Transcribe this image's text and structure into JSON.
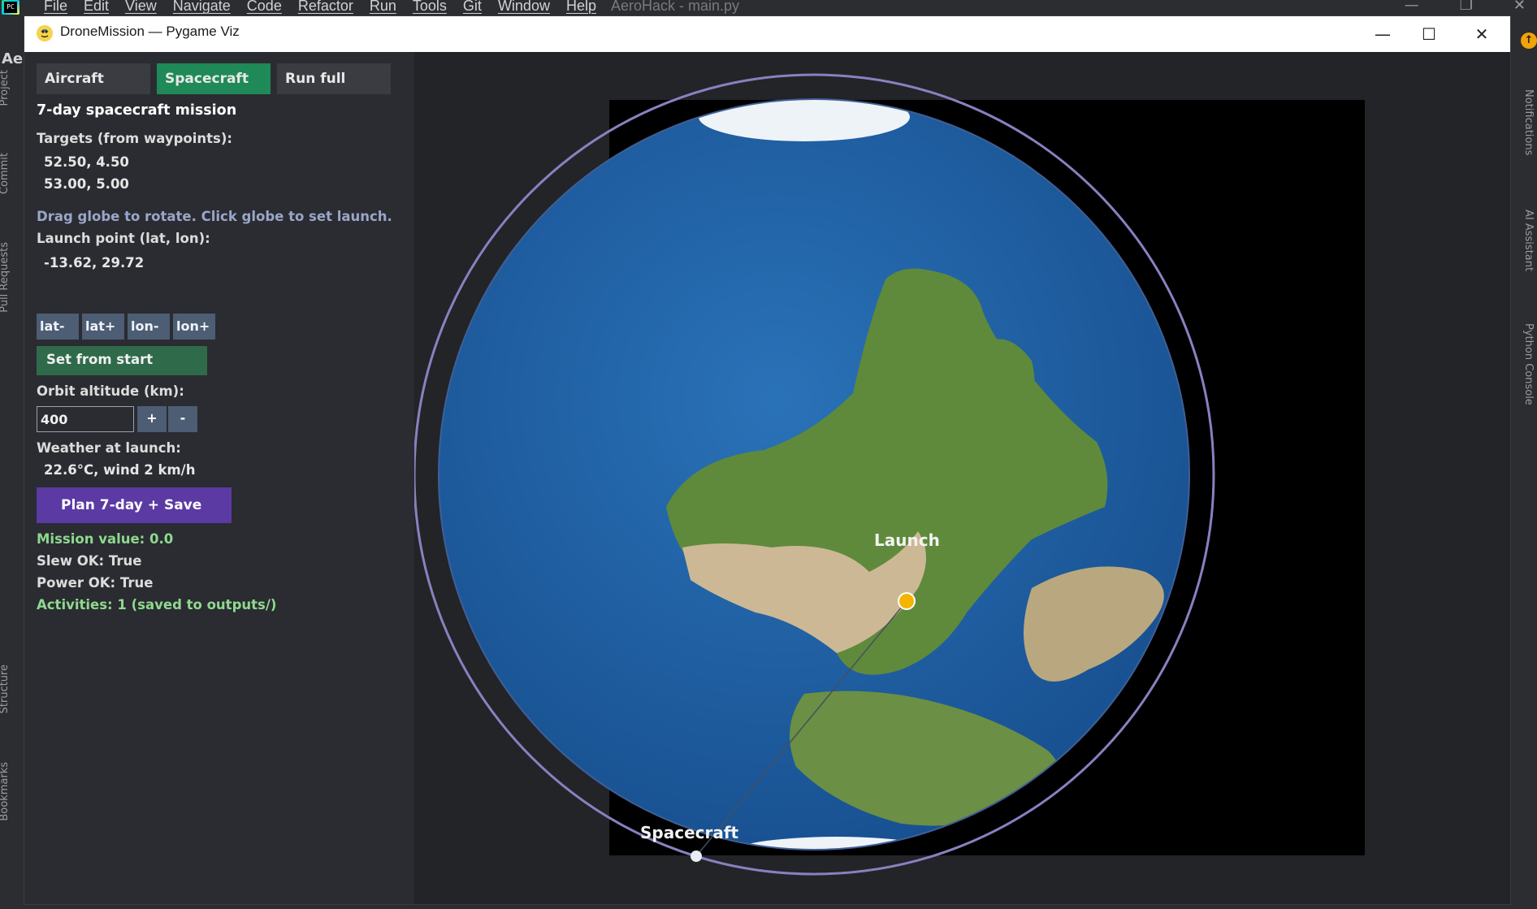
{
  "ide": {
    "logo": "PC",
    "menu": [
      "File",
      "Edit",
      "View",
      "Navigate",
      "Code",
      "Refactor",
      "Run",
      "Tools",
      "Git",
      "Window",
      "Help"
    ],
    "project_title": "AeroHack - main.py",
    "project_abbr": "Ae",
    "left_tabs": [
      "Project",
      "Commit",
      "Pull Requests",
      "Structure",
      "Bookmarks"
    ],
    "right_tabs": [
      "Notifications",
      "AI Assistant",
      "Python Console"
    ]
  },
  "window": {
    "title": "DroneMission — Pygame Viz",
    "controls": {
      "minimize": "—",
      "maximize": "☐",
      "close": "✕"
    }
  },
  "sidebar": {
    "tabs": [
      {
        "label": "Aircraft",
        "active": false
      },
      {
        "label": "Spacecraft",
        "active": true
      },
      {
        "label": "Run full",
        "active": false
      }
    ],
    "mission_title": "7-day spacecraft mission",
    "targets_header": "Targets (from waypoints):",
    "targets": [
      "52.50, 4.50",
      "53.00, 5.00"
    ],
    "drag_hint": "Drag globe to rotate. Click globe to set launch.",
    "launch_header": "Launch point (lat, lon):",
    "launch_value": "-13.62, 29.72",
    "adjust_buttons": [
      "lat-",
      "lat+",
      "lon-",
      "lon+"
    ],
    "set_from_start": "Set from start",
    "altitude_header": "Orbit altitude (km):",
    "altitude_value": "400",
    "altitude_plus": "+",
    "altitude_minus": "-",
    "weather_header": "Weather at launch:",
    "weather_value": "22.6°C, wind 2 km/h",
    "plan_button": "Plan 7-day + Save",
    "mission_value": "Mission value: 0.0",
    "slew_ok": "Slew OK: True",
    "power_ok": "Power OK: True",
    "activities": "Activities: 1 (saved to outputs/)"
  },
  "globe": {
    "launch_label": "Launch",
    "spacecraft_label": "Spacecraft",
    "colors": {
      "ocean": "#1f5fa6",
      "land_green": "#5f8a3c",
      "land_desert": "#cdb895",
      "orbit_ring": "#8a80c0",
      "launch_marker": "#f4b400",
      "spacecraft_marker": "#e8ecf4"
    }
  }
}
